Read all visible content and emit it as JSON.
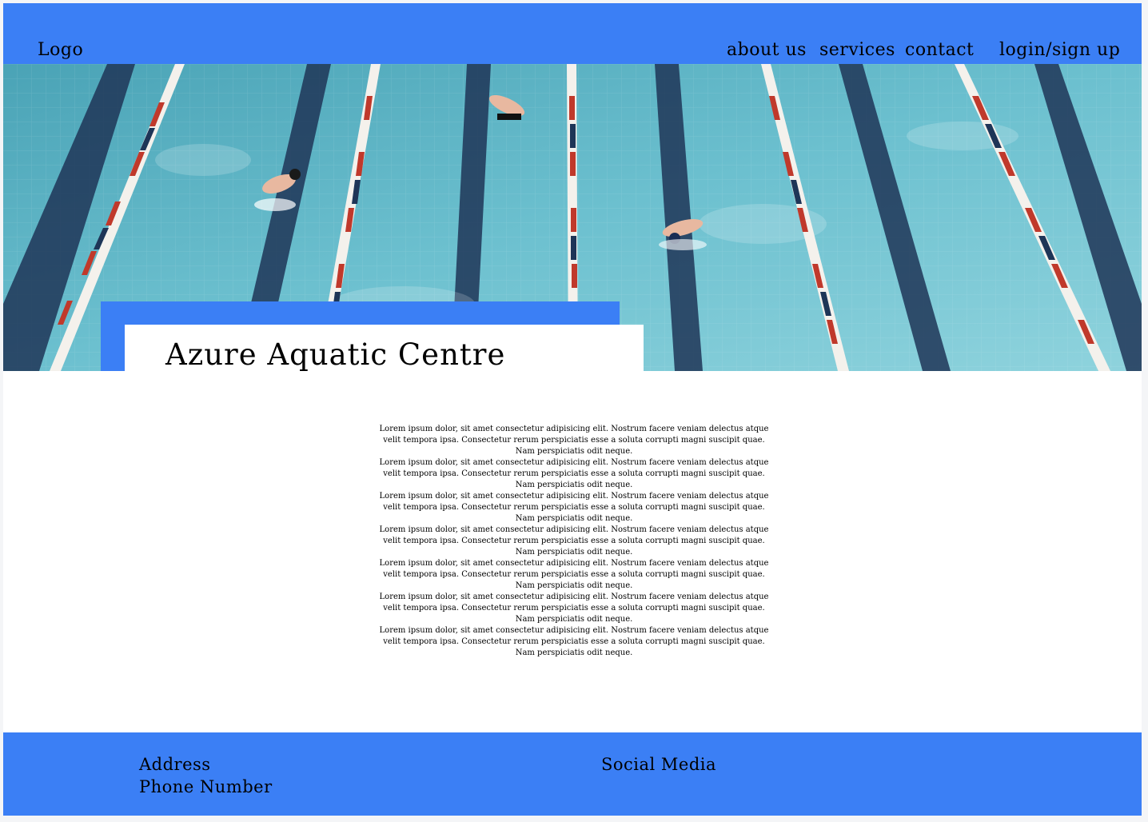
{
  "header": {
    "logo": "Logo",
    "nav": {
      "about": "about us",
      "services": "services",
      "contact": "contact",
      "login": "login/sign up"
    }
  },
  "hero": {
    "image_subject": "swimming pool lanes with swimmers"
  },
  "page": {
    "title": "Azure Aquatic Centre"
  },
  "content": {
    "paragraphs": [
      "Lorem ipsum dolor, sit amet consectetur adipisicing elit. Nostrum facere veniam delectus atque velit tempora ipsa. Consectetur rerum perspiciatis esse a soluta corrupti magni suscipit quae. Nam perspiciatis odit neque.",
      "Lorem ipsum dolor, sit amet consectetur adipisicing elit. Nostrum facere veniam delectus atque velit tempora ipsa. Consectetur rerum perspiciatis esse a soluta corrupti magni suscipit quae. Nam perspiciatis odit neque.",
      "Lorem ipsum dolor, sit amet consectetur adipisicing elit. Nostrum facere veniam delectus atque velit tempora ipsa. Consectetur rerum perspiciatis esse a soluta corrupti magni suscipit quae. Nam perspiciatis odit neque.",
      "Lorem ipsum dolor, sit amet consectetur adipisicing elit. Nostrum facere veniam delectus atque velit tempora ipsa. Consectetur rerum perspiciatis esse a soluta corrupti magni suscipit quae. Nam perspiciatis odit neque.",
      "Lorem ipsum dolor, sit amet consectetur adipisicing elit. Nostrum facere veniam delectus atque velit tempora ipsa. Consectetur rerum perspiciatis esse a soluta corrupti magni suscipit quae. Nam perspiciatis odit neque.",
      "Lorem ipsum dolor, sit amet consectetur adipisicing elit. Nostrum facere veniam delectus atque velit tempora ipsa. Consectetur rerum perspiciatis esse a soluta corrupti magni suscipit quae. Nam perspiciatis odit neque.",
      "Lorem ipsum dolor, sit amet consectetur adipisicing elit. Nostrum facere veniam delectus atque velit tempora ipsa. Consectetur rerum perspiciatis esse a soluta corrupti magni suscipit quae. Nam perspiciatis odit neque."
    ]
  },
  "footer": {
    "address": "Address",
    "phone": "Phone Number",
    "social": "Social Media"
  },
  "colors": {
    "accent": "#3b7ff5",
    "background": "#ffffff",
    "text": "#000000",
    "water": "#5fb3c4",
    "lane_red": "#c0392b"
  }
}
